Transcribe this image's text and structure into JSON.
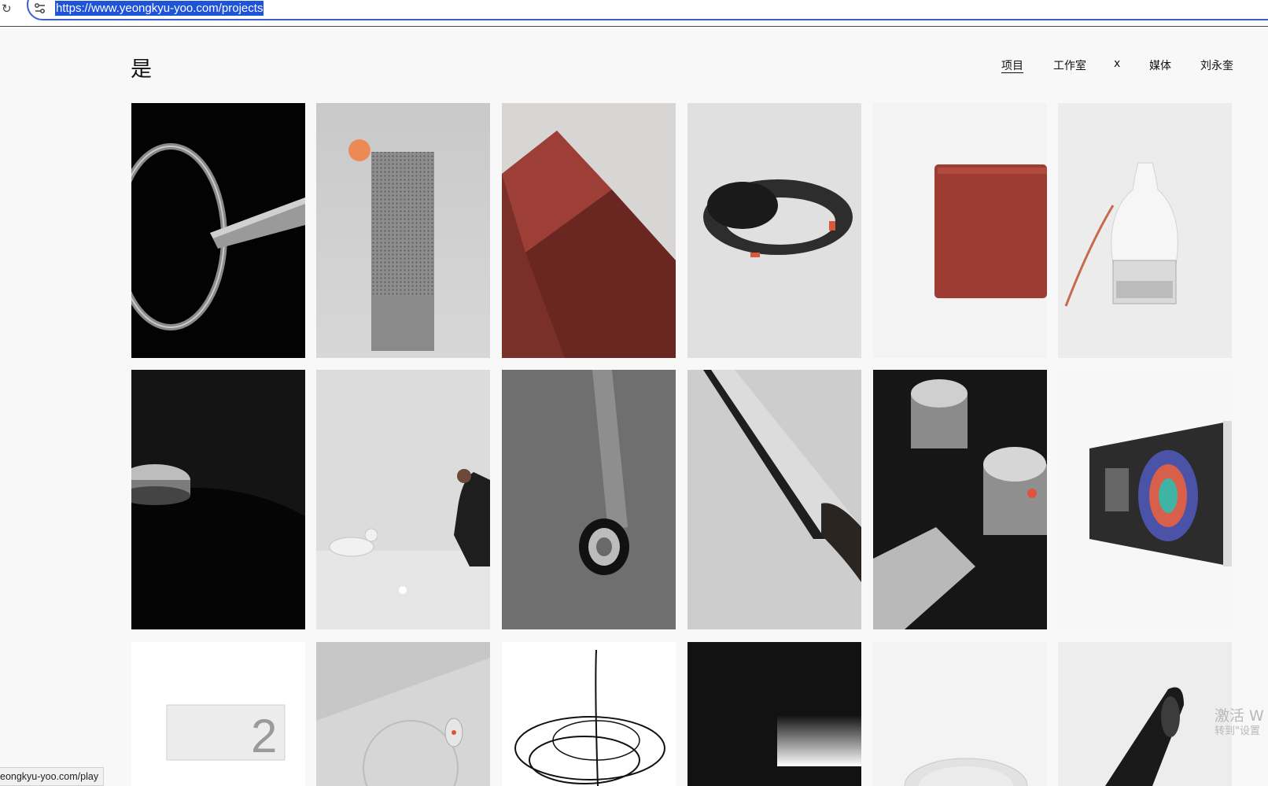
{
  "browser": {
    "url": "https://www.yeongkyu-yoo.com/projects",
    "status_url": "eongkyu-yoo.com/play",
    "reload_icon": "reload-icon",
    "site_settings_icon": "tune-icon"
  },
  "header": {
    "logo": "是",
    "nav": [
      {
        "label": "项目",
        "active": true
      },
      {
        "label": "工作室",
        "active": false
      },
      {
        "label": "x",
        "active": false
      },
      {
        "label": "媒体",
        "active": false
      },
      {
        "label": "刘永奎",
        "active": false
      }
    ]
  },
  "project_tiles": [
    {
      "name": "black-ring-product"
    },
    {
      "name": "grey-speaker-with-orange-dot"
    },
    {
      "name": "red-cylinder-paris-london"
    },
    {
      "name": "mixed-reality-headset"
    },
    {
      "name": "red-panel"
    },
    {
      "name": "white-bottle-diffuser"
    },
    {
      "name": "black-dial-device"
    },
    {
      "name": "dog-and-woman-scene"
    },
    {
      "name": "wheel-caster"
    },
    {
      "name": "tilted-tablet-in-hand"
    },
    {
      "name": "metal-cylinders-dark"
    },
    {
      "name": "wall-cd-player"
    },
    {
      "name": "white-box-number-2"
    },
    {
      "name": "grey-device-orange-button"
    },
    {
      "name": "black-line-scribble"
    },
    {
      "name": "dark-gradient-block"
    },
    {
      "name": "white-cup"
    },
    {
      "name": "black-handheld-device"
    }
  ],
  "os_watermark": {
    "line1": "激活 W",
    "line2": "转到\"设置"
  },
  "colors": {
    "accent_blue": "#1d54d9",
    "page_bg": "#f8f8f8",
    "orange": "#ec8a55",
    "brick_red": "#9e3f37"
  }
}
